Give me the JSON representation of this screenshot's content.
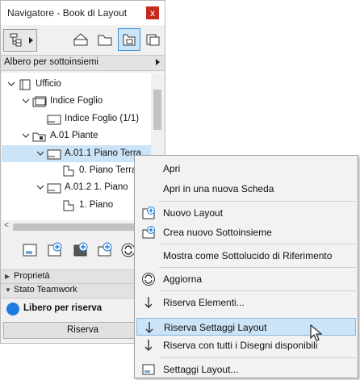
{
  "window": {
    "title": "Navigatore - Book di Layout",
    "close": "x"
  },
  "mode_dropdown": {
    "value": "Albero per sottoinsiemi"
  },
  "tree": [
    {
      "label": "Ufficio",
      "level": 0,
      "icon": "book-icon",
      "expanded": true
    },
    {
      "label": "Indice Foglio",
      "level": 1,
      "icon": "subset-icon",
      "expanded": true
    },
    {
      "label": "Indice Foglio (1/1)",
      "level": 2,
      "icon": "layout-icon"
    },
    {
      "label": "A.01 Piante",
      "level": 1,
      "icon": "subset-locked-icon",
      "expanded": true
    },
    {
      "label": "A.01.1 Piano Terra",
      "level": 2,
      "icon": "layout-icon",
      "expanded": true,
      "selected": true
    },
    {
      "label": "0. Piano Terra",
      "level": 3,
      "icon": "drawing-icon"
    },
    {
      "label": "A.01.2 1. Piano",
      "level": 2,
      "icon": "layout-icon",
      "expanded": true
    },
    {
      "label": "1. Piano",
      "level": 3,
      "icon": "drawing-icon"
    }
  ],
  "sections": {
    "properties": "Proprietà",
    "teamwork": "Stato Teamwork"
  },
  "teamwork": {
    "status": "Libero per riserva",
    "status_color": "#1d7be0",
    "reserve_button": "Riserva"
  },
  "context_menu": {
    "items": [
      {
        "label": "Apri",
        "icon": ""
      },
      {
        "label": "Apri in una nuova Scheda",
        "icon": ""
      },
      {
        "label": "Nuovo Layout",
        "icon": "new-layout-icon"
      },
      {
        "label": "Crea nuovo Sottoinsieme",
        "icon": "new-subset-icon"
      },
      {
        "label": "Mostra come Sottolucido di Riferimento",
        "icon": ""
      },
      {
        "label": "Aggiorna",
        "icon": "refresh-icon"
      },
      {
        "label": "Riserva Elementi...",
        "icon": "reserve-arrow-icon"
      },
      {
        "label": "Riserva Settaggi Layout",
        "icon": "reserve-arrow-icon",
        "highlighted": true
      },
      {
        "label": "Riserva con tutti i Disegni disponibili",
        "icon": "reserve-arrow-icon"
      },
      {
        "label": "Settaggi Layout...",
        "icon": "layout-settings-icon"
      }
    ]
  }
}
